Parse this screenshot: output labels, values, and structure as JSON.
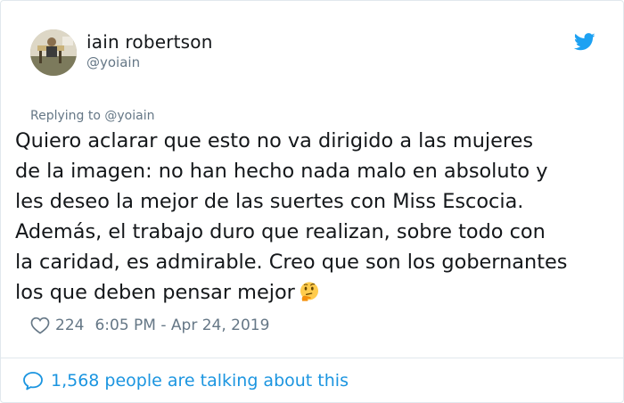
{
  "author": {
    "display_name": "iain robertson",
    "handle": "@yoiain",
    "avatar": "profile-photo",
    "platform_icon": "twitter-bird-icon",
    "brand_color": "#1da1f2"
  },
  "reply": {
    "text": "Replying to @yoiain"
  },
  "tweet": {
    "lines": [
      "Quiero aclarar que esto no va dirigido a las mujeres",
      "de la imagen: no han hecho nada malo en absoluto y",
      "les deseo la mejor de las suertes con Miss Escocia.",
      "Además, el trabajo duro que realizan, sobre todo con",
      "la caridad, es admirable. Creo que son los gobernantes",
      "los que deben pensar mejor"
    ],
    "emoji": "thinking-face-emoji"
  },
  "meta": {
    "like_icon": "heart-icon",
    "likes": "224",
    "timestamp": "6:05 PM - Apr 24, 2019"
  },
  "footer": {
    "icon": "speech-bubble-icon",
    "text": "1,568 people are talking about this",
    "link_color": "#1b95e0"
  }
}
